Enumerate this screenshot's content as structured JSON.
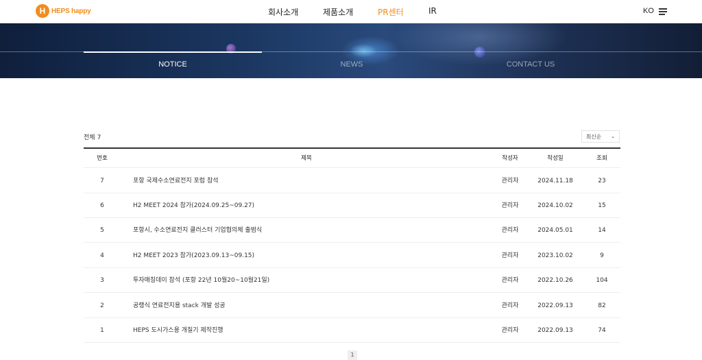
{
  "header": {
    "logo_mark": "H",
    "logo_text": "HEPS happy",
    "nav": [
      "회사소개",
      "제품소개",
      "PR센터",
      "IR"
    ],
    "active_nav": "PR센터",
    "lang": "KO",
    "accent_color": "#f28c1e"
  },
  "sub_tabs": [
    "NOTICE",
    "NEWS",
    "CONTACT US"
  ],
  "active_tab": "NOTICE",
  "board": {
    "total_label": "전체",
    "total_count": "7",
    "sort_selected": "최신순",
    "columns": {
      "no": "번호",
      "title": "제목",
      "writer": "작성자",
      "date": "작성일",
      "views": "조회"
    },
    "rows": [
      {
        "no": "7",
        "title": "포항 국제수소연료전지 포럼 참석",
        "writer": "관리자",
        "date": "2024.11.18",
        "views": "23"
      },
      {
        "no": "6",
        "title": "H2 MEET 2024 참가(2024.09.25~09.27)",
        "writer": "관리자",
        "date": "2024.10.02",
        "views": "15"
      },
      {
        "no": "5",
        "title": "포항시, 수소연료전지 클러스터 기업협의체 출범식",
        "writer": "관리자",
        "date": "2024.05.01",
        "views": "14"
      },
      {
        "no": "4",
        "title": "H2 MEET 2023 참가(2023.09.13~09.15)",
        "writer": "관리자",
        "date": "2023.10.02",
        "views": "9"
      },
      {
        "no": "3",
        "title": "투자매칭데이 참석 (포항 22년 10월20~10월21일)",
        "writer": "관리자",
        "date": "2022.10.26",
        "views": "104"
      },
      {
        "no": "2",
        "title": "공랭식 연료전지용 stack 개발 성공",
        "writer": "관리자",
        "date": "2022.09.13",
        "views": "82"
      },
      {
        "no": "1",
        "title": "HEPS 도시가스용 개질기 제작진행",
        "writer": "관리자",
        "date": "2022.09.13",
        "views": "74"
      }
    ]
  },
  "pagination": {
    "current": "1"
  }
}
